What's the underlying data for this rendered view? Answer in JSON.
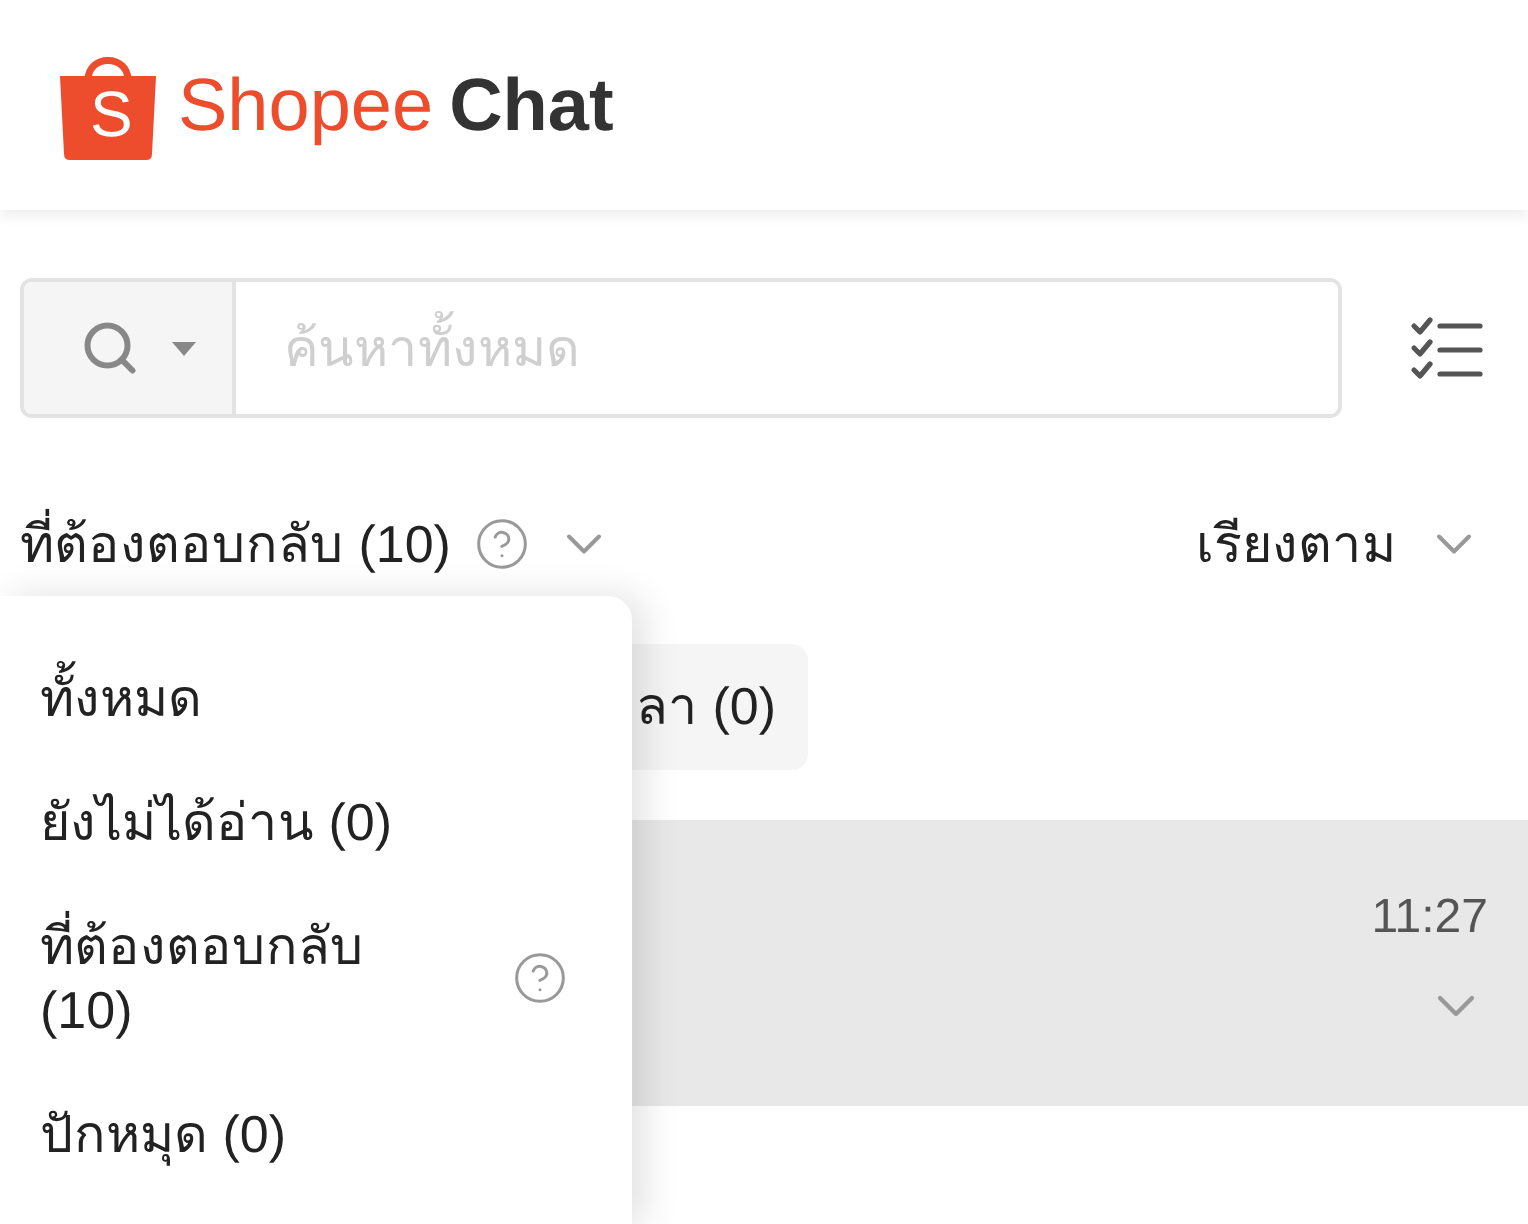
{
  "header": {
    "logo_letter": "S",
    "brand": "Shopee",
    "title": "Chat"
  },
  "search": {
    "placeholder": "ค้นหาทั้งหมด"
  },
  "filter": {
    "label": "ที่ต้องตอบกลับ (10)"
  },
  "sort": {
    "label": "เรียงตาม"
  },
  "chips": [
    {
      "label": "ลา (0)"
    }
  ],
  "chats": [
    {
      "time": "11:27",
      "selected": true
    }
  ],
  "menu": {
    "items": [
      {
        "label": "ทั้งหมด",
        "kind": "plain"
      },
      {
        "label": "ยังไม่ได้อ่าน (0)",
        "kind": "plain"
      },
      {
        "label": "ที่ต้องตอบกลับ (10)",
        "kind": "help"
      },
      {
        "label": "ปักหมุด (0)",
        "kind": "plain"
      }
    ]
  }
}
